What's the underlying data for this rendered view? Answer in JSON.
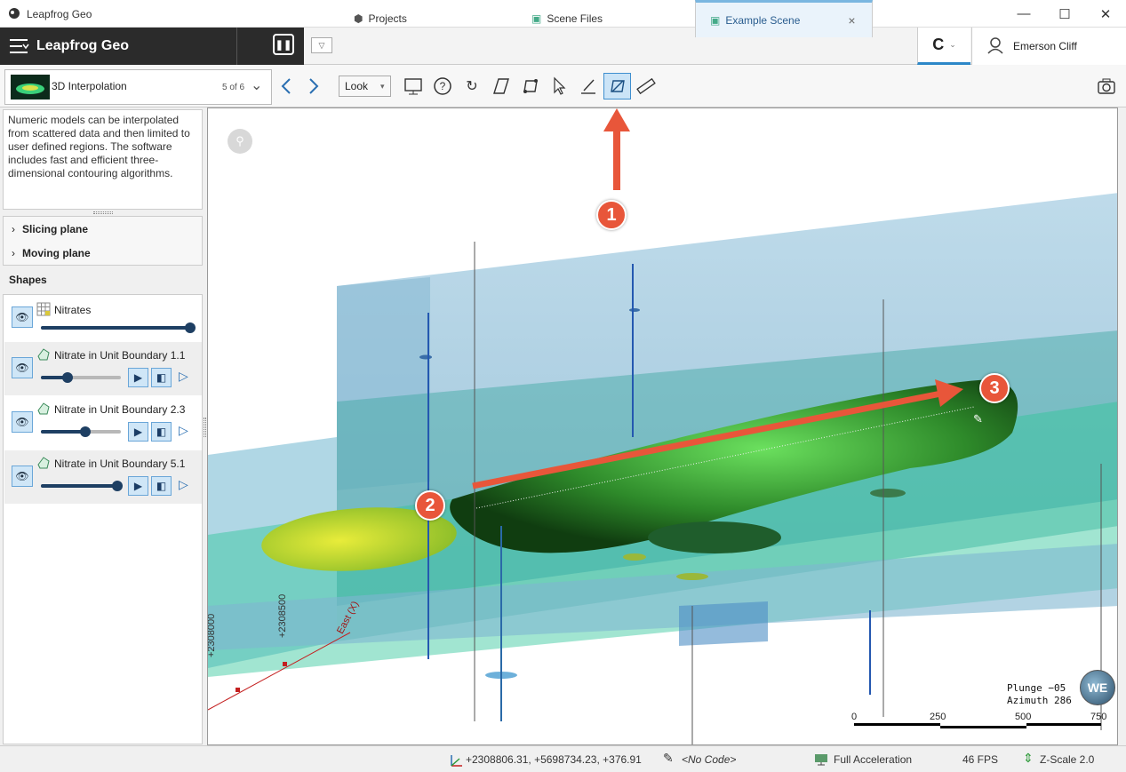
{
  "window": {
    "title": "Leapfrog Geo"
  },
  "brand": {
    "name": "Leapfrog Geo"
  },
  "tabs": {
    "projects": "Projects",
    "scene_files": "Scene Files",
    "example_scene": "Example Scene",
    "close": "×"
  },
  "user": {
    "name": "Emerson Cliff"
  },
  "scene": {
    "name": "3D Interpolation",
    "count": "5 of 6"
  },
  "look": {
    "label": "Look"
  },
  "description": "Numeric models can be interpolated from scattered data and then limited to user defined regions. The software includes fast and efficient three-dimensional contouring algorithms.",
  "planes": {
    "slicing": "Slicing plane",
    "moving": "Moving plane"
  },
  "shapes": {
    "title": "Shapes",
    "items": [
      {
        "name": "Nitrates",
        "level": 1.0
      },
      {
        "name": "Nitrate in Unit Boundary 1.1",
        "level": 0.33
      },
      {
        "name": "Nitrate in Unit Boundary 2.3",
        "level": 0.55
      },
      {
        "name": "Nitrate in Unit Boundary 5.1",
        "level": 0.95
      }
    ]
  },
  "viewport": {
    "plunge": "Plunge −05",
    "azimuth": "Azimuth 286",
    "scale_labels": [
      "0",
      "250",
      "500",
      "750"
    ],
    "axis_labels": [
      "+2308000",
      "+2308500",
      "East (X)"
    ],
    "badges": [
      "1",
      "2",
      "3"
    ]
  },
  "status": {
    "coords": "+2308806.31, +5698734.23, +376.91",
    "code": "<No Code>",
    "accel": "Full Acceleration",
    "fps": "46 FPS",
    "zscale": "Z-Scale 2.0"
  }
}
